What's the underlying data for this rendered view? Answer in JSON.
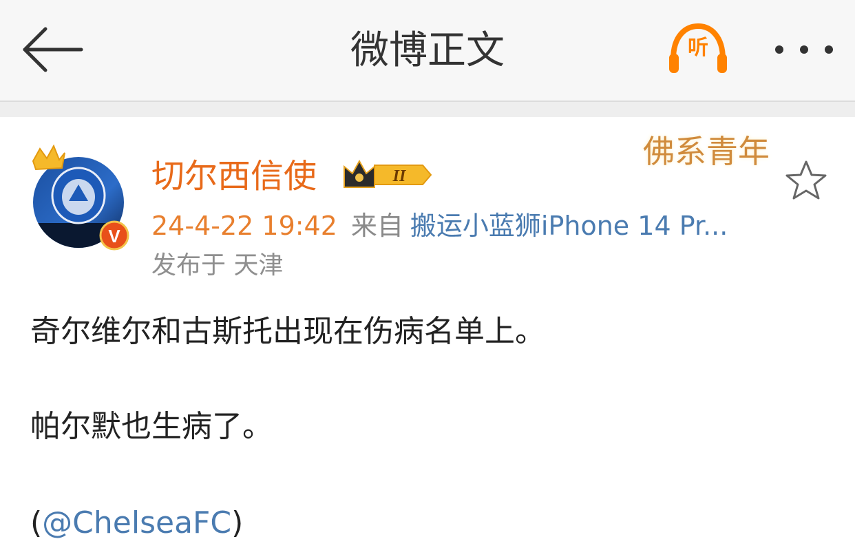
{
  "header": {
    "title": "微博正文",
    "listen_label": "听",
    "accent_color": "#ff8200"
  },
  "post": {
    "author": "切尔西信使",
    "member_level": "II",
    "decoration_text": "佛系青年",
    "time": "24-4-22 19:42",
    "from_label": "来自",
    "source": "搬运小蓝狮iPhone 14 Pr...",
    "location": "发布于 天津",
    "verified_badge": "V",
    "paragraphs": [
      "奇尔维尔和古斯托出现在伤病名单上。",
      "帕尔默也生病了。"
    ],
    "mention": {
      "open": "(",
      "handle": "@ChelseaFC",
      "close": ")"
    }
  },
  "icons": {
    "back": "arrow-left-icon",
    "listen": "headphones-icon",
    "more": "more-dots-icon",
    "favorite": "star-outline-icon",
    "crown": "crown-icon",
    "verified": "verified-v-icon"
  },
  "colors": {
    "username": "#e86a1a",
    "time": "#e87f2e",
    "link": "#4a7bb0",
    "muted": "#8f8f8f",
    "text": "#222222"
  }
}
